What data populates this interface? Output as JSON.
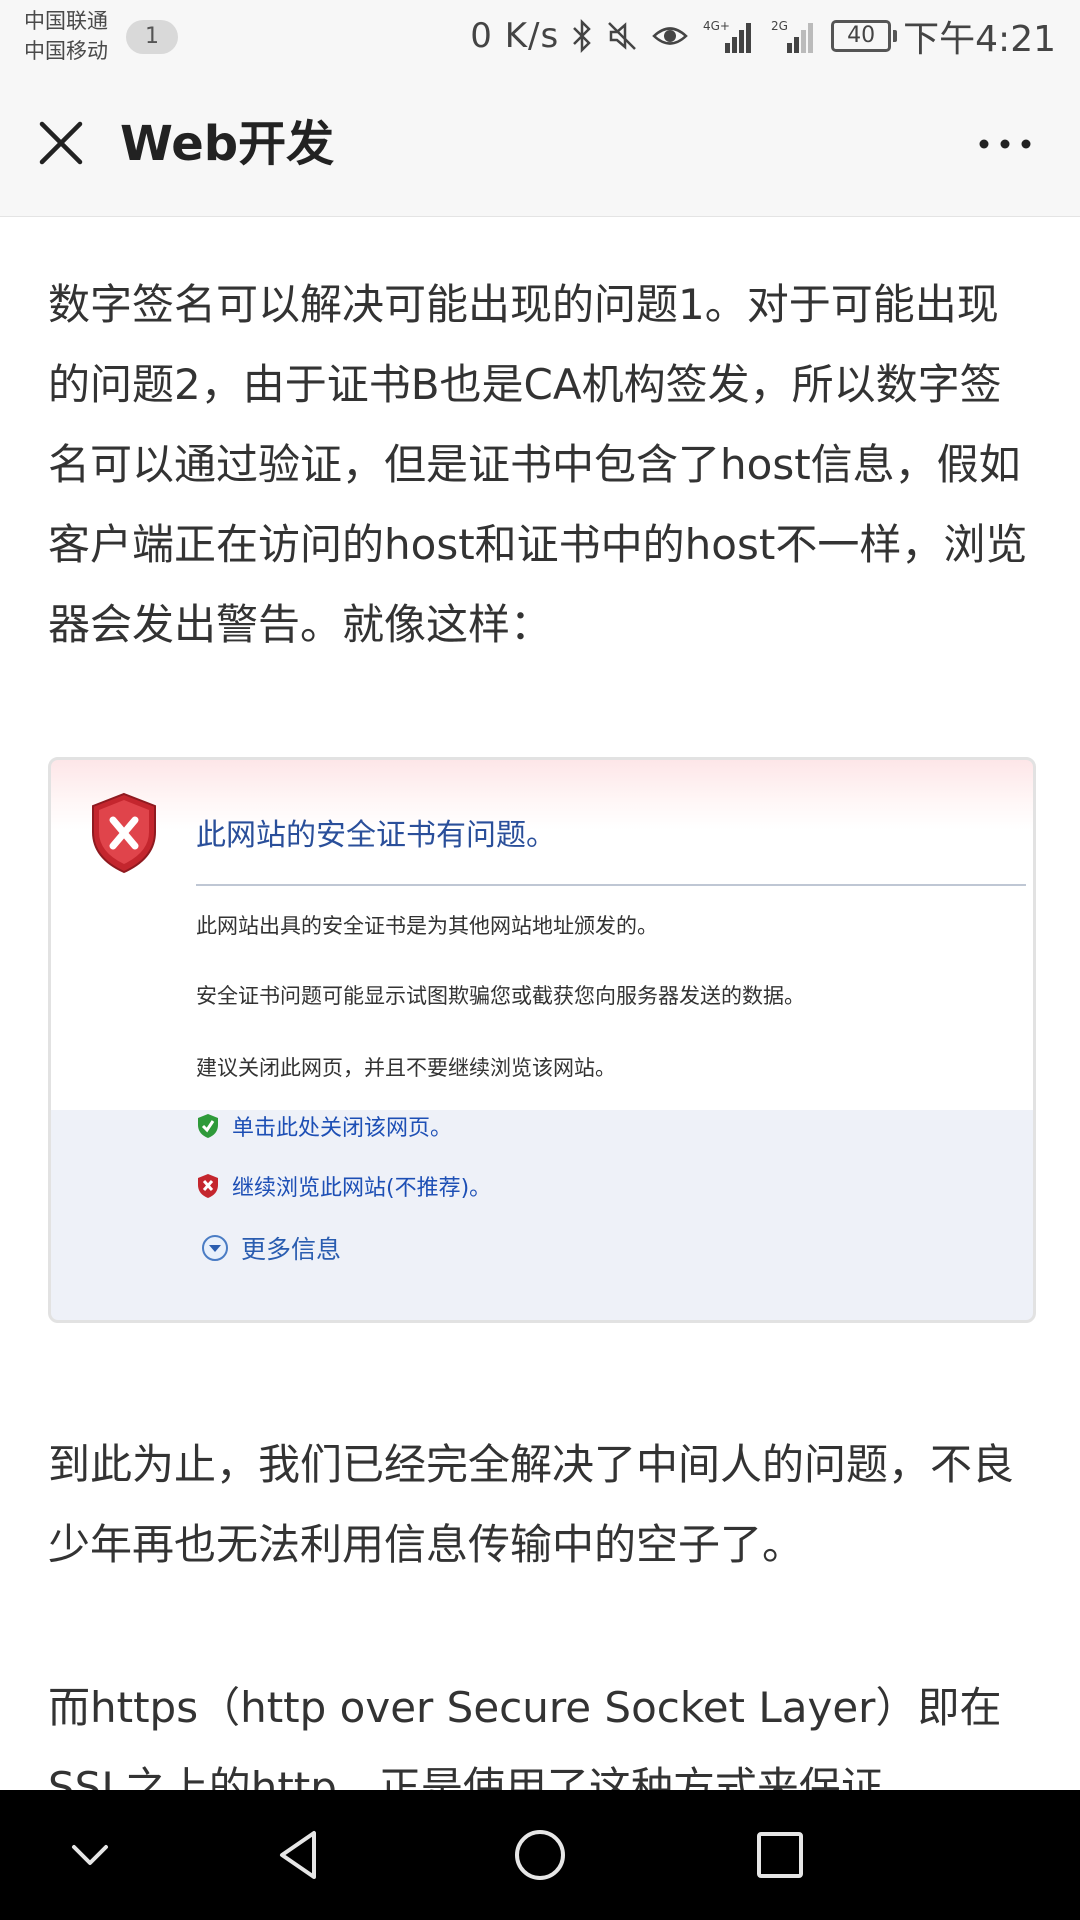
{
  "status_bar": {
    "carrier_1": "中国联通",
    "carrier_2": "中国移动",
    "notification_count": "1",
    "net_speed": "0 K/s",
    "signal_1_label": "4G+",
    "signal_2_label": "2G",
    "battery": "40",
    "time": "下午4:21"
  },
  "nav": {
    "title": "Web开发"
  },
  "article": {
    "paragraph_1": "数字签名可以解决可能出现的问题1。对于可能出现的问题2，由于证书B也是CA机构签发，所以数字签名可以通过验证，但是证书中包含了host信息，假如客户端正在访问的host和证书中的host不一样，浏览器会发出警告。就像这样：",
    "figure": {
      "heading": "此网站的安全证书有问题。",
      "line_1": "此网站出具的安全证书是为其他网站地址颁发的。",
      "line_2": "安全证书问题可能显示试图欺骗您或截获您向服务器发送的数据。",
      "line_3": "建议关闭此网页，并且不要继续浏览该网站。",
      "link_close": "单击此处关闭该网页。",
      "link_continue": "继续浏览此网站(不推荐)。",
      "link_more": "更多信息"
    },
    "paragraph_2": "到此为止，我们已经完全解决了中间人的问题，不良少年再也无法利用信息传输中的空子了。",
    "paragraph_3": "而https（http over Secure Socket Layer）即在SSL之上的http，正是使用了这种方式来保证"
  },
  "icons": {
    "close": "close-icon",
    "more": "more-icon",
    "bluetooth": "bluetooth-icon",
    "mute": "mute-icon",
    "eye": "eye-icon",
    "back": "back-icon",
    "home": "home-icon",
    "recents": "recents-icon",
    "collapse": "chevron-down-icon"
  }
}
